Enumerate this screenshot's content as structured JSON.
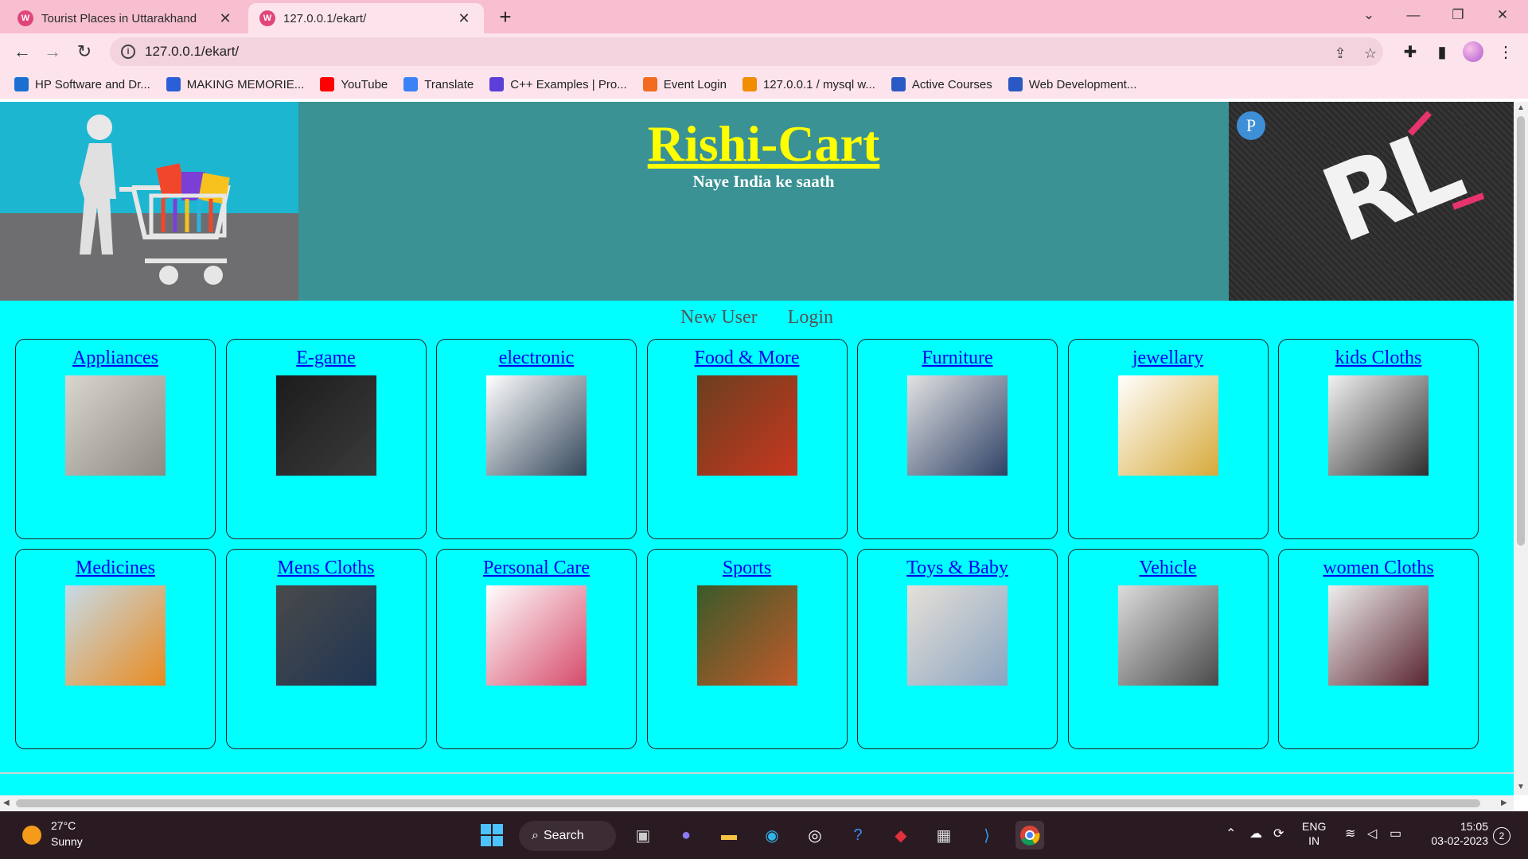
{
  "browser": {
    "tabs": [
      {
        "title": "Tourist Places in Uttarakhand",
        "active": false
      },
      {
        "title": "127.0.0.1/ekart/",
        "active": true
      }
    ],
    "url": "127.0.0.1/ekart/",
    "bookmarks": [
      {
        "label": "HP Software and Dr...",
        "icon": "hp-icon",
        "color": "#1a6fd1"
      },
      {
        "label": "MAKING MEMORIE...",
        "icon": "doc-icon",
        "color": "#2b5fd8"
      },
      {
        "label": "YouTube",
        "icon": "youtube-icon",
        "color": "#ff0000"
      },
      {
        "label": "Translate",
        "icon": "translate-icon",
        "color": "#3b82f6"
      },
      {
        "label": "C++ Examples | Pro...",
        "icon": "programiz-icon",
        "color": "#5b3fd8"
      },
      {
        "label": "Event Login",
        "icon": "power-icon",
        "color": "#f26b21"
      },
      {
        "label": "127.0.0.1 / mysql w...",
        "icon": "phpmyadmin-icon",
        "color": "#f28c00"
      },
      {
        "label": "Active Courses",
        "icon": "courses-icon",
        "color": "#2b59c3"
      },
      {
        "label": "Web Development...",
        "icon": "courses-icon",
        "color": "#2b59c3"
      }
    ]
  },
  "site": {
    "title": "Rishi-Cart",
    "tagline": "Naye India ke saath",
    "links": {
      "new_user": "New User",
      "login": "Login"
    },
    "categories": [
      {
        "name": "Appliances",
        "colors": [
          "#d9d6cf",
          "#8d8a84"
        ]
      },
      {
        "name": "E-game",
        "colors": [
          "#1c1c1c",
          "#3b3b3b"
        ]
      },
      {
        "name": "electronic",
        "colors": [
          "#ffffff",
          "#34475a"
        ]
      },
      {
        "name": "Food & More",
        "colors": [
          "#6b3f1f",
          "#c8371f"
        ]
      },
      {
        "name": "Furniture",
        "colors": [
          "#e2e2e2",
          "#2f4266"
        ]
      },
      {
        "name": "jewellary",
        "colors": [
          "#ffffff",
          "#d6a93a"
        ]
      },
      {
        "name": "kids Cloths",
        "colors": [
          "#f2f2f2",
          "#2e2e2e"
        ]
      },
      {
        "name": "Medicines",
        "colors": [
          "#c6dbe8",
          "#e88b1f"
        ]
      },
      {
        "name": "Mens Cloths",
        "colors": [
          "#4a4a4a",
          "#1f3553"
        ]
      },
      {
        "name": "Personal Care",
        "colors": [
          "#ffffff",
          "#d64a6a"
        ]
      },
      {
        "name": "Sports",
        "colors": [
          "#3a5a2a",
          "#c25a2a"
        ]
      },
      {
        "name": "Toys & Baby",
        "colors": [
          "#e6e0d8",
          "#8aa4c0"
        ]
      },
      {
        "name": "Vehicle",
        "colors": [
          "#dcdcdc",
          "#4a4a4a"
        ]
      },
      {
        "name": "women Cloths",
        "colors": [
          "#eeeeee",
          "#5a2530"
        ]
      }
    ]
  },
  "taskbar": {
    "weather": {
      "temp": "27°C",
      "desc": "Sunny"
    },
    "search_label": "Search",
    "lang": {
      "line1": "ENG",
      "line2": "IN"
    },
    "clock": {
      "time": "15:05",
      "date": "03-02-2023"
    },
    "notifications": "2"
  }
}
